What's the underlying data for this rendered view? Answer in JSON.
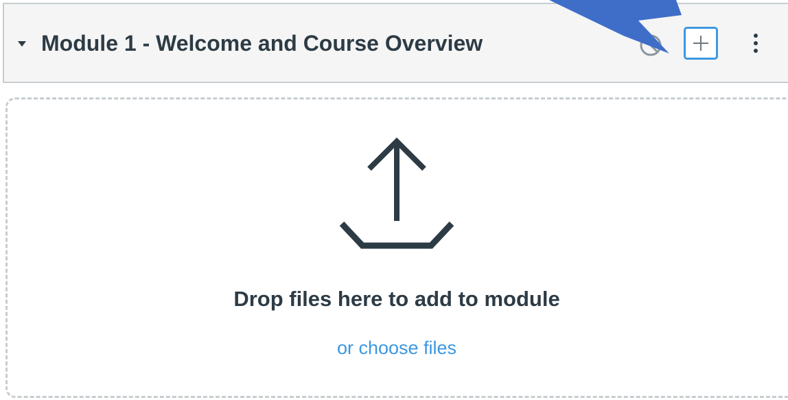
{
  "module": {
    "title": "Module 1 - Welcome and Course Overview",
    "collapse_icon": "caret-down-icon",
    "publish_status_icon": "unpublished-icon",
    "add_button_icon": "plus-icon",
    "menu_icon": "kebab-menu-icon"
  },
  "dropzone": {
    "icon": "upload-icon",
    "primary_text": "Drop files here to add to module",
    "link_text": "or choose files"
  },
  "annotation": {
    "icon": "pointer-arrow-icon",
    "color": "#3f6ec9"
  },
  "colors": {
    "accent": "#3d97e0",
    "text": "#2d3b45",
    "header_bg": "#f5f5f5",
    "border": "#c7cdd1"
  }
}
